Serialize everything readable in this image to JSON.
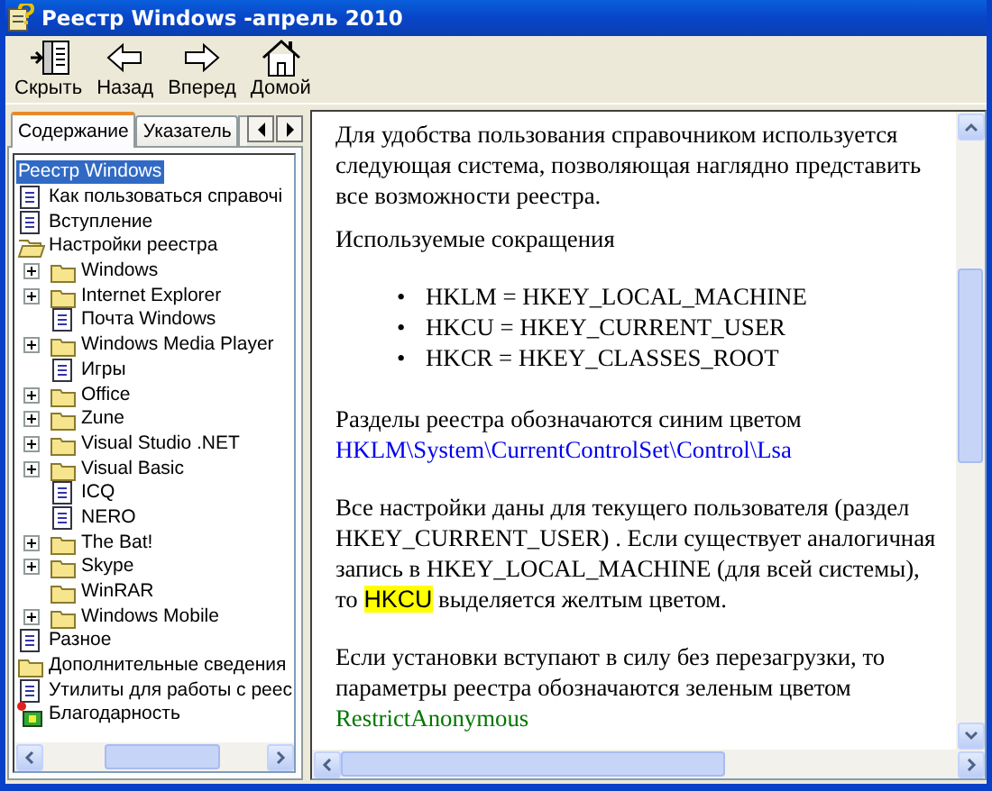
{
  "window": {
    "title": "Реестр Windows -апрель 2010"
  },
  "toolbar": [
    {
      "kind": "hide",
      "label": "Скрыть"
    },
    {
      "kind": "back",
      "label": "Назад"
    },
    {
      "kind": "forward",
      "label": "Вперед"
    },
    {
      "kind": "home",
      "label": "Домой"
    }
  ],
  "nav_tabs": [
    {
      "label": "Содержание",
      "selected": true
    },
    {
      "label": "Указатель",
      "selected": false
    }
  ],
  "tree": [
    {
      "label": "Реестр Windows",
      "kind": "none",
      "selected": true
    },
    {
      "label": "Как пользоваться справочі",
      "kind": "page",
      "selected": false
    },
    {
      "label": "Вступление",
      "kind": "page",
      "selected": false
    },
    {
      "label": "Настройки реестра",
      "kind": "open-folder",
      "selected": false,
      "children": [
        {
          "label": "Windows",
          "kind": "folder",
          "expandable": true,
          "selected": false
        },
        {
          "label": "Internet Explorer",
          "kind": "folder",
          "expandable": true,
          "selected": false
        },
        {
          "label": "Почта Windows",
          "kind": "page",
          "expandable": false,
          "selected": false
        },
        {
          "label": "Windows Media Player",
          "kind": "folder",
          "expandable": true,
          "selected": false
        },
        {
          "label": "Игры",
          "kind": "page",
          "expandable": false,
          "selected": false
        },
        {
          "label": "Office",
          "kind": "folder",
          "expandable": true,
          "selected": false
        },
        {
          "label": "Zune",
          "kind": "folder",
          "expandable": true,
          "selected": false
        },
        {
          "label": "Visual Studio .NET",
          "kind": "folder",
          "expandable": true,
          "selected": false
        },
        {
          "label": "Visual Basic",
          "kind": "folder",
          "expandable": true,
          "selected": false
        },
        {
          "label": "ICQ",
          "kind": "page",
          "expandable": false,
          "selected": false
        },
        {
          "label": "NERO",
          "kind": "page",
          "expandable": false,
          "selected": false
        },
        {
          "label": "The Bat!",
          "kind": "folder",
          "expandable": true,
          "selected": false
        },
        {
          "label": "Skype",
          "kind": "folder",
          "expandable": true,
          "selected": false
        },
        {
          "label": "WinRAR",
          "kind": "folder",
          "expandable": false,
          "selected": false
        },
        {
          "label": "Windows Mobile",
          "kind": "folder",
          "expandable": true,
          "selected": false
        }
      ]
    },
    {
      "label": "Разное",
      "kind": "page",
      "selected": false
    },
    {
      "label": "Дополнительные сведения",
      "kind": "folder",
      "selected": false
    },
    {
      "label": "Утилиты для работы с реес",
      "kind": "page",
      "selected": false
    },
    {
      "label": "Благодарность",
      "kind": "special",
      "selected": false
    }
  ],
  "content": [
    {
      "kind": "paragraph",
      "parts": [
        {
          "kind": "plain",
          "text": "Для удобства пользования справочником используется следующая система, позволяющая наглядно представить все возможности реестра."
        }
      ]
    },
    {
      "kind": "paragraph",
      "parts": [
        {
          "kind": "plain",
          "text": "Используемые сокращения"
        }
      ]
    },
    {
      "kind": "list",
      "items": [
        {
          "marker": "•",
          "text": "HKLM = HKEY_LOCAL_MACHINE"
        },
        {
          "marker": "•",
          "text": "HKCU = HKEY_CURRENT_USER"
        },
        {
          "marker": "•",
          "text": "HKCR = HKEY_CLASSES_ROOT"
        }
      ]
    },
    {
      "kind": "paragraph",
      "parts": [
        {
          "kind": "plain",
          "text": "Разделы реестра обозначаются синим цветом "
        },
        {
          "kind": "key-path",
          "text": "HKLM\\System\\CurrentControlSet\\Control\\Lsa"
        }
      ]
    },
    {
      "kind": "paragraph",
      "parts": [
        {
          "kind": "plain",
          "text": "Все настройки даны для текущего пользователя (раздел HKEY_CURRENT_USER) . Если существует аналогичная запись в HKEY_LOCAL_MACHINE (для всей системы), то "
        },
        {
          "kind": "highlight",
          "text": "HKCU"
        },
        {
          "kind": "plain",
          "text": " выделяется желтым цветом."
        }
      ]
    },
    {
      "kind": "paragraph",
      "parts": [
        {
          "kind": "plain",
          "text": "Если установки вступают в силу без перезагрузки, то параметры реестра обозначаются зеленым цветом "
        },
        {
          "kind": "parameter",
          "text": "RestrictAnonymous"
        }
      ]
    }
  ]
}
